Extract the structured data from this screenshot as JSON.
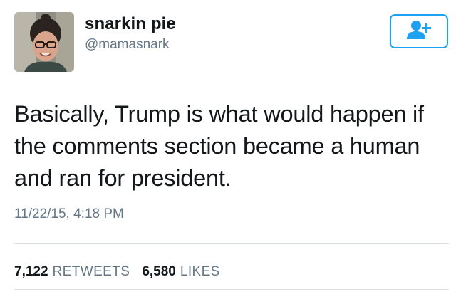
{
  "user": {
    "display_name": "snarkin pie",
    "handle": "@mamasnark",
    "avatar_icon": "profile-photo"
  },
  "follow_button": {
    "icon": "add-user-icon",
    "color": "#1da1f2"
  },
  "tweet": {
    "text_line1": "Basically, Trump is what would happen if",
    "text_line2": "the comments section became a human",
    "text_line3": "and ran for president.",
    "timestamp": "11/22/15, 4:18 PM"
  },
  "stats": {
    "retweets_count": "7,122",
    "retweets_label": "RETWEETS",
    "likes_count": "6,580",
    "likes_label": "LIKES"
  },
  "colors": {
    "text_primary": "#14171a",
    "text_secondary": "#657786",
    "accent": "#1da1f2",
    "divider": "#d8dee3"
  }
}
